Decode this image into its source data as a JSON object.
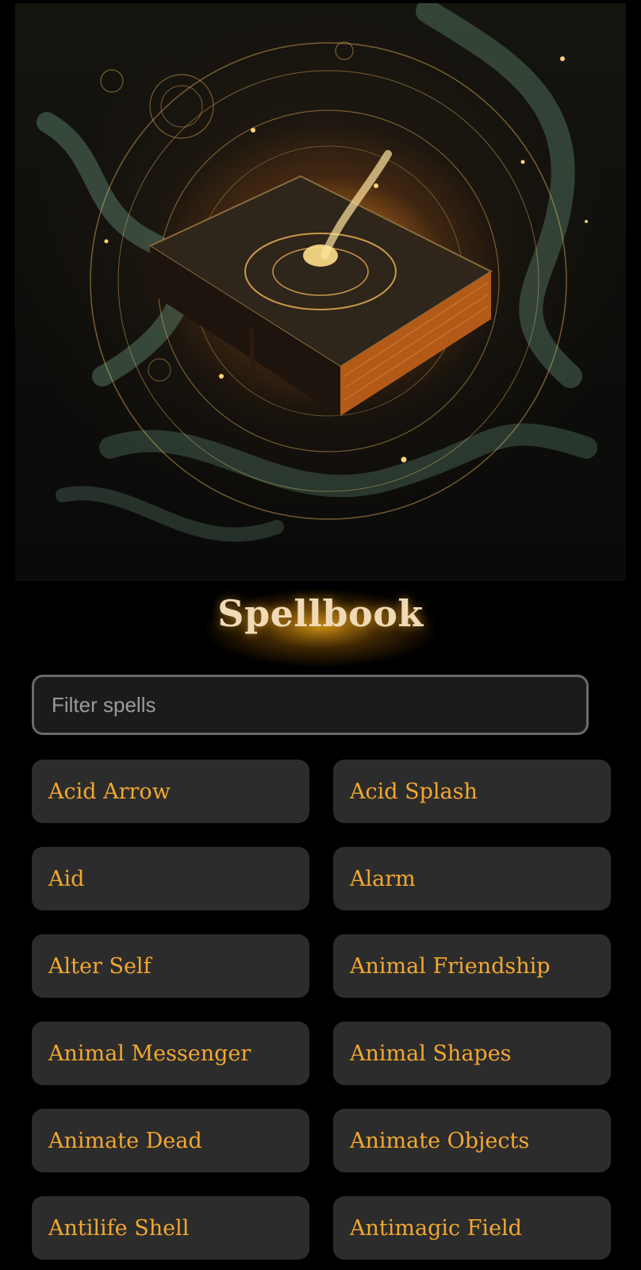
{
  "header": {
    "hero_image": "spellbook-hero-image",
    "title": "Spellbook"
  },
  "search": {
    "placeholder": "Filter spells",
    "value": ""
  },
  "spells": [
    "Acid Arrow",
    "Acid Splash",
    "Aid",
    "Alarm",
    "Alter Self",
    "Animal Friendship",
    "Animal Messenger",
    "Animal Shapes",
    "Animate Dead",
    "Animate Objects",
    "Antilife Shell",
    "Antimagic Field"
  ],
  "colors": {
    "background": "#000000",
    "card": "#2c2c2c",
    "spell_text": "#f2a830",
    "title_text": "#f0d9b5",
    "title_glow": "#f5aa14",
    "input_border": "#6a6a6a"
  }
}
